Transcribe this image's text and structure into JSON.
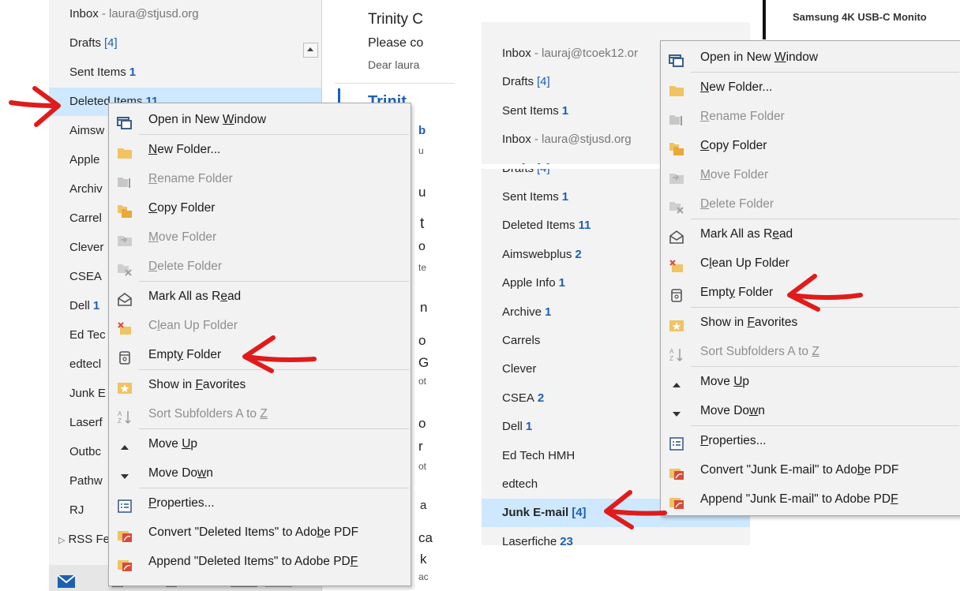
{
  "left": {
    "folders": [
      {
        "name": "Inbox",
        "account": " - laura@stjusd.org"
      },
      {
        "name": "Drafts",
        "count_bracket": "[4]"
      },
      {
        "name": "Sent Items",
        "count": "1"
      },
      {
        "name": "Deleted Items",
        "count": "11"
      },
      {
        "name": "Aimsw"
      },
      {
        "name": "Apple"
      },
      {
        "name": "Archiv"
      },
      {
        "name": "Carrel"
      },
      {
        "name": "Clever"
      },
      {
        "name": "CSEA"
      },
      {
        "name": "Dell",
        "count": "1"
      },
      {
        "name": "Ed Tec"
      },
      {
        "name": "edtecl"
      },
      {
        "name": "Junk E"
      },
      {
        "name": "Laserf"
      },
      {
        "name": "Outbc"
      },
      {
        "name": "Pathw"
      },
      {
        "name": "RJ"
      },
      {
        "name": "RSS Fe"
      }
    ],
    "mail": {
      "sender": "Trinity C",
      "subject": "Please co",
      "preview": "Dear laura",
      "sender2": "Trinit",
      "frag1": "b",
      "frag2": "u",
      "frag3": "u",
      "frag4": "t",
      "frag5": "o",
      "frag6": "te",
      "frag7": "n",
      "frag8": "o",
      "frag9": "G",
      "frag10": "ot",
      "frag11": "o",
      "frag12": "r",
      "frag13": "ot",
      "frag14": "a",
      "frag15": "ca",
      "frag16": "k",
      "frag17": "ac"
    },
    "menu_items": [
      {
        "label": "Open in New Window",
        "icon": "open-window-icon"
      },
      {
        "label": "New Folder...",
        "icon": "new-folder-icon"
      },
      {
        "label": "Rename Folder",
        "icon": "rename-folder-icon",
        "disabled": true
      },
      {
        "label": "Copy Folder",
        "icon": "copy-folder-icon"
      },
      {
        "label": "Move Folder",
        "icon": "move-folder-icon",
        "disabled": true
      },
      {
        "label": "Delete Folder",
        "icon": "delete-folder-icon",
        "disabled": true
      },
      {
        "label": "Mark All as Read",
        "icon": "mark-read-icon"
      },
      {
        "label": "Clean Up Folder",
        "icon": "clean-up-icon",
        "disabled": true
      },
      {
        "label": "Empty Folder",
        "icon": "empty-folder-icon"
      },
      {
        "label": "Show in Favorites",
        "icon": "favorites-star-icon"
      },
      {
        "label": "Sort Subfolders A to Z",
        "icon": "sort-az-icon",
        "disabled": true
      },
      {
        "label": "Move Up",
        "icon": "move-up-icon"
      },
      {
        "label": "Move Down",
        "icon": "move-down-icon"
      },
      {
        "label": "Properties...",
        "icon": "properties-icon"
      },
      {
        "label": "Convert \"Deleted Items\" to Adobe PDF",
        "icon": "adobe-pdf-icon"
      },
      {
        "label": "Append \"Deleted Items\" to Adobe PDF",
        "icon": "adobe-pdf-icon"
      }
    ]
  },
  "right": {
    "header_fragment": "Samsung 4K USB-C Monito",
    "folders": [
      {
        "name": "Inbox",
        "account": " - lauraj@tcoek12.or"
      },
      {
        "name": "Drafts",
        "count_bracket": "[4]"
      },
      {
        "name": "Sent Items",
        "count": "1"
      },
      {
        "name": "Inbox",
        "account": " - laura@stjusd.org"
      },
      {
        "name": "Drafts",
        "count_bracket": "[4]"
      },
      {
        "name": "Sent Items",
        "count": "1"
      },
      {
        "name": "Deleted Items",
        "count": "11"
      },
      {
        "name": "Aimswebplus",
        "count": "2"
      },
      {
        "name": "Apple Info",
        "count": "1"
      },
      {
        "name": "Archive",
        "count": "1"
      },
      {
        "name": "Carrels"
      },
      {
        "name": "Clever"
      },
      {
        "name": "CSEA",
        "count": "2"
      },
      {
        "name": "Dell",
        "count": "1"
      },
      {
        "name": "Ed Tech HMH"
      },
      {
        "name": "edtech"
      },
      {
        "name": "Junk E-mail",
        "count_bracket": "[4]"
      },
      {
        "name": "Laserfiche",
        "count": "23"
      }
    ],
    "menu_items": [
      {
        "label": "Open in New Window",
        "icon": "open-window-icon"
      },
      {
        "label": "New Folder...",
        "icon": "new-folder-icon"
      },
      {
        "label": "Rename Folder",
        "icon": "rename-folder-icon",
        "disabled": true
      },
      {
        "label": "Copy Folder",
        "icon": "copy-folder-icon"
      },
      {
        "label": "Move Folder",
        "icon": "move-folder-icon",
        "disabled": true
      },
      {
        "label": "Delete Folder",
        "icon": "delete-folder-icon",
        "disabled": true
      },
      {
        "label": "Mark All as Read",
        "icon": "mark-read-icon"
      },
      {
        "label": "Clean Up Folder",
        "icon": "clean-up-icon"
      },
      {
        "label": "Empty Folder",
        "icon": "empty-folder-icon"
      },
      {
        "label": "Show in Favorites",
        "icon": "favorites-star-icon"
      },
      {
        "label": "Sort Subfolders A to Z",
        "icon": "sort-az-icon",
        "disabled": true
      },
      {
        "label": "Move Up",
        "icon": "move-up-icon"
      },
      {
        "label": "Move Down",
        "icon": "move-down-icon"
      },
      {
        "label": "Properties...",
        "icon": "properties-icon"
      },
      {
        "label": "Convert \"Junk E-mail\" to Adobe PDF",
        "icon": "adobe-pdf-icon"
      },
      {
        "label": "Append \"Junk E-mail\" to Adobe PDF",
        "icon": "adobe-pdf-icon"
      }
    ]
  },
  "colors": {
    "annotation": "#e01b1b",
    "selection": "#cde8ff",
    "count": "#1e5fb4",
    "menu_bg": "#f2f2f2"
  }
}
